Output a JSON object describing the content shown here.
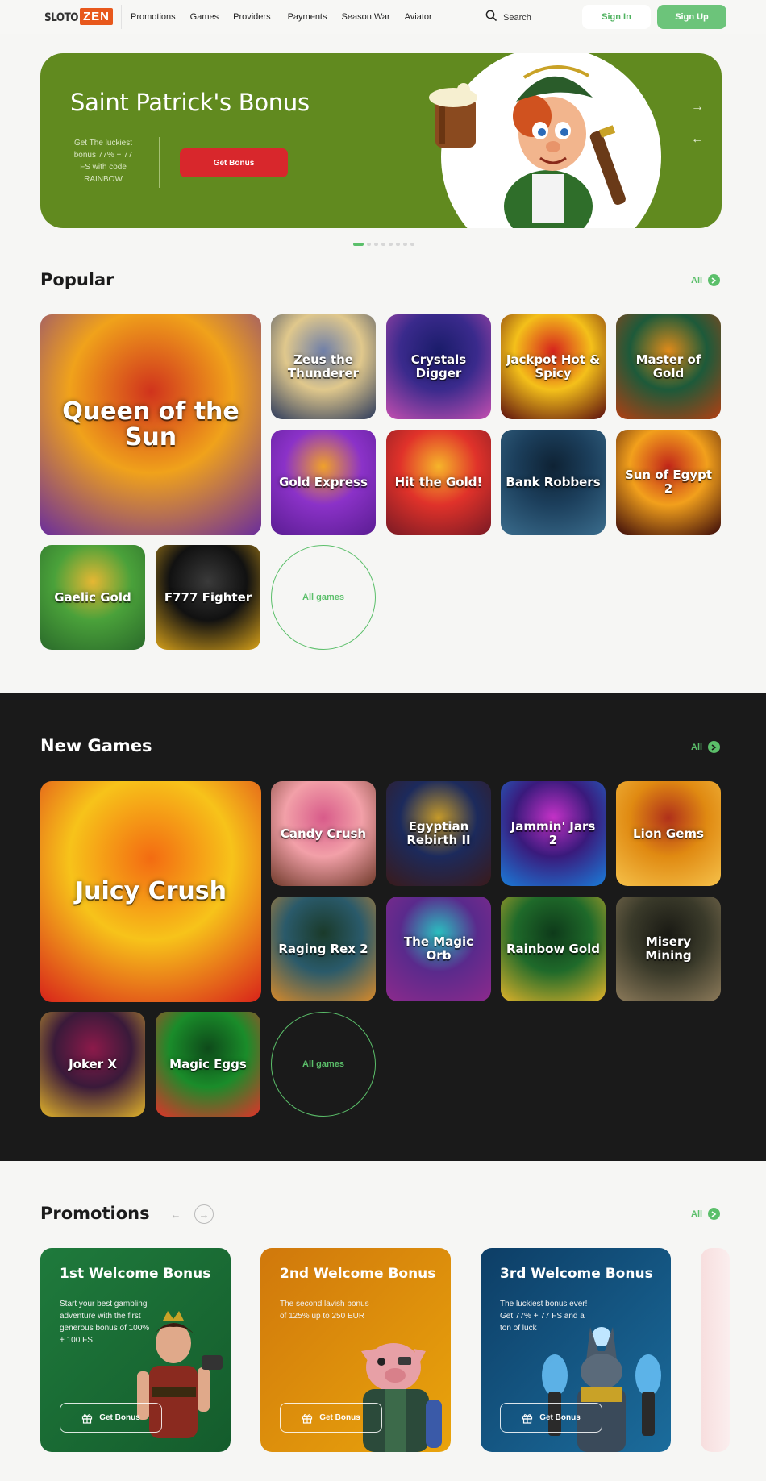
{
  "header": {
    "logo_text": "SLOTO",
    "logo_accent": "ZEN",
    "nav": [
      "Promotions",
      "Games",
      "Providers",
      "Payments",
      "Season War",
      "Aviator"
    ],
    "search_label": "Search",
    "signin_label": "Sign In",
    "signup_label": "Sign Up"
  },
  "hero": {
    "title": "Saint Patrick's Bonus",
    "description": "Get The luckiest bonus 77% + 77 FS with code RAINBOW",
    "button": "Get Bonus",
    "background": "#618a1f",
    "slides": 8,
    "active_slide": 1
  },
  "popular": {
    "title": "Popular",
    "all_label": "All",
    "all_games_label": "All games",
    "games": [
      {
        "name": "Queen of the Sun",
        "colors": [
          "#f0a21b",
          "#d0331c",
          "#6a2d9c"
        ]
      },
      {
        "name": "Zeus the Thunderer",
        "colors": [
          "#e0c88c",
          "#6f7fa8",
          "#2c3a5c"
        ]
      },
      {
        "name": "Crystals Digger",
        "colors": [
          "#3a2a8c",
          "#1a1c6a",
          "#c54fb0"
        ]
      },
      {
        "name": "Jackpot Hot & Spicy",
        "colors": [
          "#f4c01a",
          "#d6231d",
          "#5a0e0e"
        ]
      },
      {
        "name": "Master of Gold",
        "colors": [
          "#1d5a3a",
          "#e08b1a",
          "#b33f12"
        ]
      },
      {
        "name": "Gold Express",
        "colors": [
          "#8b32c8",
          "#f0a12a",
          "#5b1d93"
        ]
      },
      {
        "name": "Hit the Gold!",
        "colors": [
          "#e0322a",
          "#f6b52a",
          "#7a1a24"
        ]
      },
      {
        "name": "Bank Robbers",
        "colors": [
          "#1c3f5c",
          "#0e2234",
          "#3a6c8c"
        ]
      },
      {
        "name": "Sun of Egypt 2",
        "colors": [
          "#f2a01c",
          "#c2261a",
          "#3a0a0a"
        ]
      },
      {
        "name": "Gaelic Gold",
        "colors": [
          "#4aa13a",
          "#e6b733",
          "#2a6a2a"
        ]
      },
      {
        "name": "F777 Fighter",
        "colors": [
          "#111111",
          "#3a3a3a",
          "#d8a21a"
        ]
      }
    ]
  },
  "new_games": {
    "title": "New Games",
    "all_label": "All",
    "all_games_label": "All games",
    "games": [
      {
        "name": "Juicy Crush",
        "colors": [
          "#f7c31a",
          "#f36b12",
          "#d8231a"
        ]
      },
      {
        "name": "Candy Crush",
        "colors": [
          "#f2a0a8",
          "#d85b8a",
          "#6f3a2a"
        ]
      },
      {
        "name": "Egyptian Rebirth II",
        "colors": [
          "#1c2a5c",
          "#c59a2a",
          "#3a1a1a"
        ]
      },
      {
        "name": "Jammin' Jars 2",
        "colors": [
          "#3a1a7c",
          "#c532c8",
          "#1a7cd8"
        ]
      },
      {
        "name": "Lion Gems",
        "colors": [
          "#e08a12",
          "#b0301a",
          "#f5c14a"
        ]
      },
      {
        "name": "Raging Rex 2",
        "colors": [
          "#2a5a6a",
          "#1a3a2a",
          "#d88a2a"
        ]
      },
      {
        "name": "The Magic Orb",
        "colors": [
          "#5a2a8c",
          "#2ac0c0",
          "#8c2a8c"
        ]
      },
      {
        "name": "Rainbow Gold",
        "colors": [
          "#1f6a2a",
          "#0e3a1a",
          "#e0b22a"
        ]
      },
      {
        "name": "Misery Mining",
        "colors": [
          "#3a3a2a",
          "#1a1a14",
          "#8c7a5a"
        ]
      },
      {
        "name": "Joker X",
        "colors": [
          "#3a1a3a",
          "#8c1a4a",
          "#e0b22a"
        ]
      },
      {
        "name": "Magic Eggs",
        "colors": [
          "#1a8c2a",
          "#0e4a1a",
          "#e0322a"
        ]
      }
    ]
  },
  "promotions": {
    "title": "Promotions",
    "all_label": "All",
    "cards": [
      {
        "title": "1st Welcome Bonus",
        "description": "Start your best gambling adventure with the first generous bonus of 100% + 100 FS",
        "button": "Get Bonus",
        "colors": [
          "#1f7a3c",
          "#145c2c"
        ]
      },
      {
        "title": "2nd Welcome Bonus",
        "description": "The second lavish bonus of 125% up to 250 EUR",
        "button": "Get Bonus",
        "colors": [
          "#d0780c",
          "#e9a40c"
        ]
      },
      {
        "title": "3rd Welcome Bonus",
        "description": "The luckiest bonus ever! Get 77% + 77 FS and a ton of luck",
        "button": "Get Bonus",
        "colors": [
          "#0d3e66",
          "#1b6c9c"
        ]
      }
    ]
  }
}
